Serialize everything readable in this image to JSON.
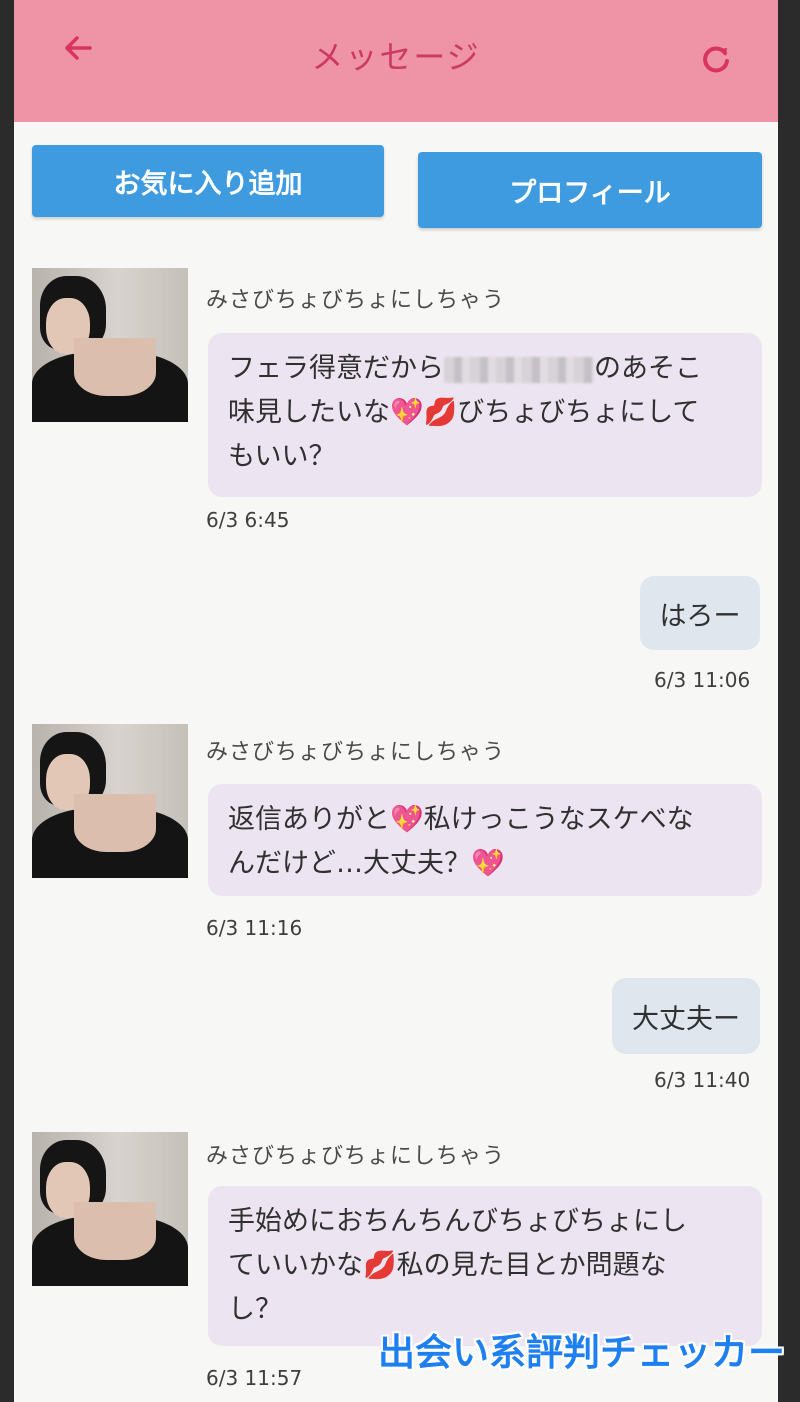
{
  "header": {
    "title": "メッセージ",
    "back_icon": "back-arrow-icon",
    "reload_icon": "reload-icon",
    "background": "#ef93a7",
    "title_color": "#cc3a63"
  },
  "actions": {
    "favorite_label": "お気に入り追加",
    "profile_label": "プロフィール",
    "button_color": "#3f9be0"
  },
  "messages": [
    {
      "direction": "incoming",
      "sender": "みさびちょびちょにしちゃう",
      "text_lines": [
        "フェラ得意だから",
        "のあそこ",
        "味見したいな💖💋びちょびちょにして",
        "もいい？"
      ],
      "time": "6/3 6:45"
    },
    {
      "direction": "outgoing",
      "text": "はろー",
      "time": "6/3 11:06"
    },
    {
      "direction": "incoming",
      "sender": "みさびちょびちょにしちゃう",
      "text_lines": [
        "返信ありがと💖私けっこうなスケべな",
        "んだけど…大丈夫？💖"
      ],
      "time": "6/3 11:16"
    },
    {
      "direction": "outgoing",
      "text": "大丈夫ー",
      "time": "6/3 11:40"
    },
    {
      "direction": "incoming",
      "sender": "みさびちょびちょにしちゃう",
      "text_lines": [
        "手始めにおちんちんびちょびちょにし",
        "ていいかな💋私の見た目とか問題な",
        "し？"
      ],
      "time": "6/3 11:57"
    }
  ],
  "watermark": "出会い系評判チェッカー"
}
